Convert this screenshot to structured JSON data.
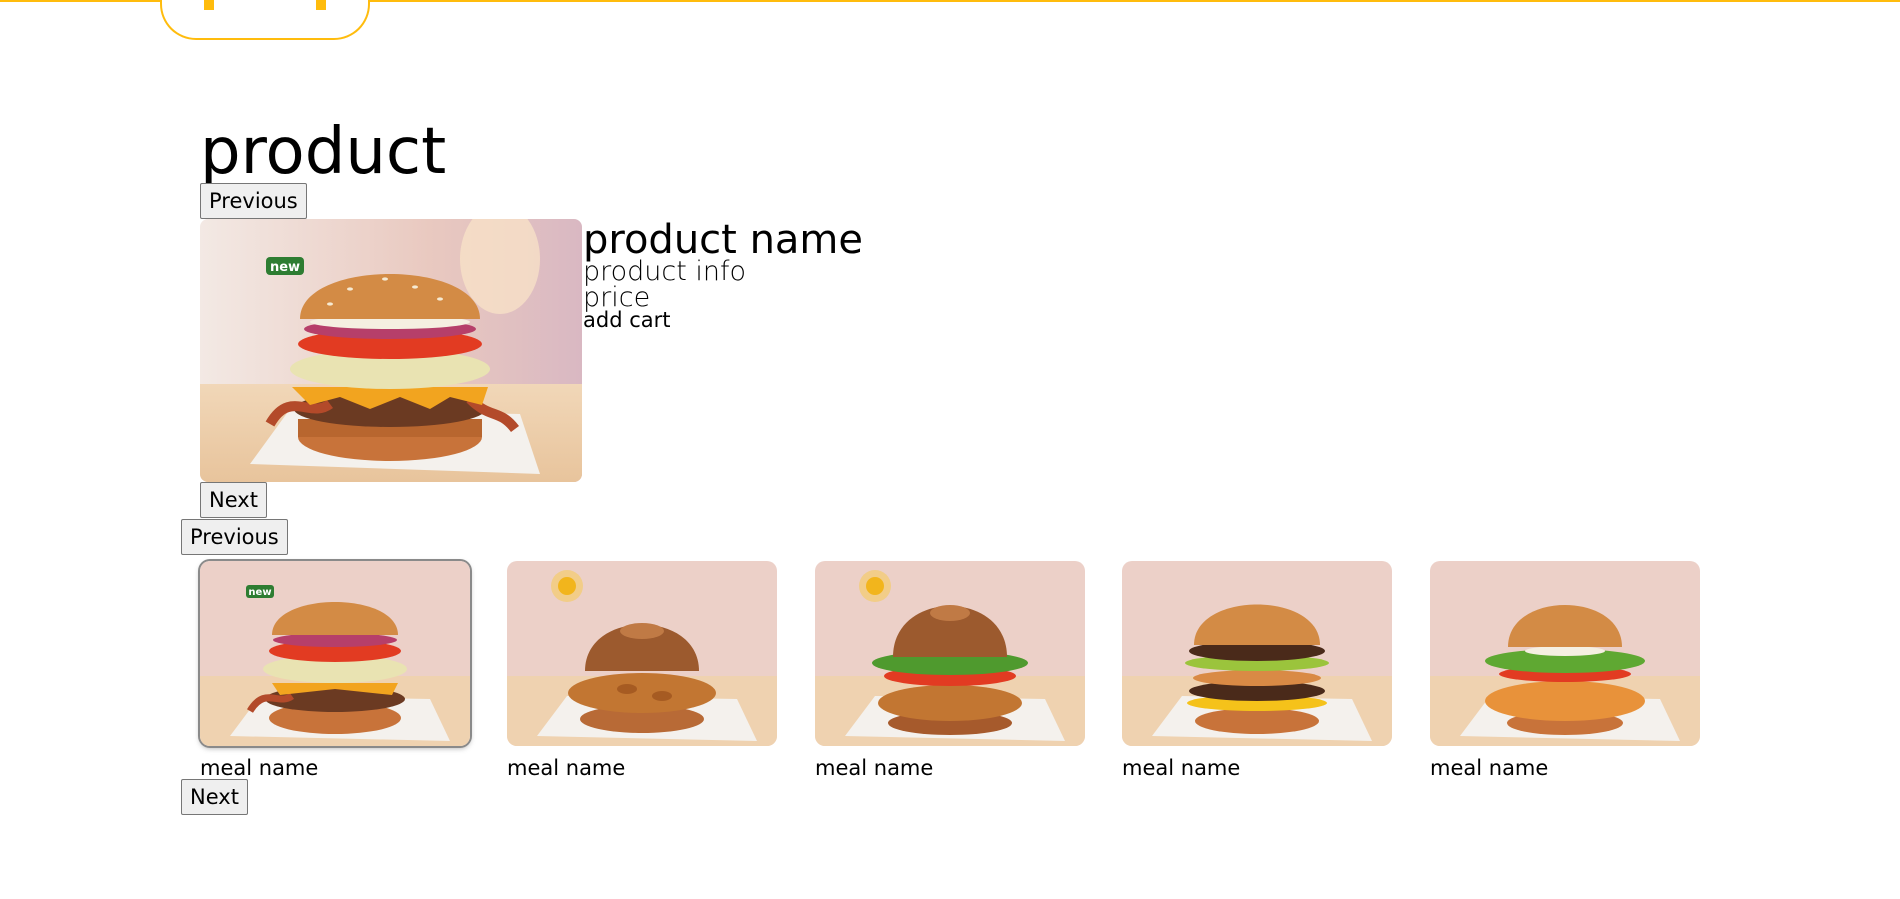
{
  "page": {
    "title": "product"
  },
  "carousel": {
    "previous_label": "Previous",
    "next_label": "Next"
  },
  "product": {
    "name": "product name",
    "info": "product info",
    "price": "price",
    "add_cart_label": "add cart",
    "image_icon": "burger-bacon-tomato-image"
  },
  "meals_carousel": {
    "previous_label": "Previous",
    "next_label": "Next",
    "items": [
      {
        "name": "meal name",
        "image_icon": "burger-bacon-tomato-image",
        "selected": true
      },
      {
        "name": "meal name",
        "image_icon": "crispy-chicken-sandwich-image",
        "selected": false
      },
      {
        "name": "meal name",
        "image_icon": "chicken-lettuce-tomato-sandwich-image",
        "selected": false
      },
      {
        "name": "meal name",
        "image_icon": "double-burger-image",
        "selected": false
      },
      {
        "name": "meal name",
        "image_icon": "chicken-lettuce-burger-image",
        "selected": false
      }
    ]
  },
  "colors": {
    "brand_yellow": "#ffbc0d",
    "badge_green": "#2e7d32"
  }
}
